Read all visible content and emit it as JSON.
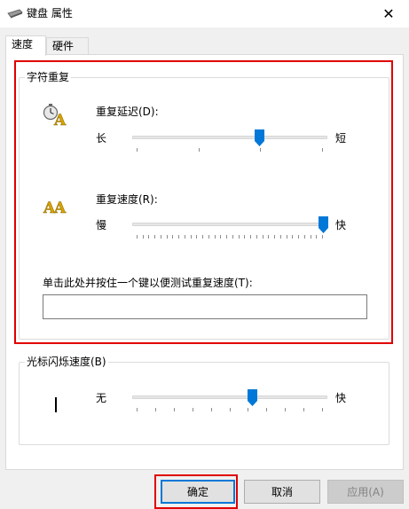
{
  "window": {
    "title": "键盘 属性",
    "icon": "keyboard-icon",
    "close_glyph": "✕"
  },
  "tabs": [
    {
      "label": "速度",
      "active": true
    },
    {
      "label": "硬件",
      "active": false
    }
  ],
  "char_repeat": {
    "legend": "字符重复",
    "delay": {
      "label": "重复延迟(D):",
      "min_label": "长",
      "max_label": "短",
      "icon": "repeat-delay-icon",
      "value_fraction": 0.66,
      "tick_count": 4
    },
    "rate": {
      "label": "重复速度(R):",
      "min_label": "慢",
      "max_label": "快",
      "icon": "repeat-rate-icon",
      "value_fraction": 1.0,
      "tick_count": 32
    },
    "test_label": "单击此处并按住一个键以便测试重复速度(T):",
    "test_value": ""
  },
  "cursor_blink": {
    "legend": "光标闪烁速度(B)",
    "min_label": "无",
    "max_label": "快",
    "value_fraction": 0.62,
    "tick_count": 11
  },
  "buttons": {
    "ok": "确定",
    "cancel": "取消",
    "apply": "应用(A)"
  },
  "colors": {
    "accent": "#0078d7",
    "highlight_box": "#e00000"
  }
}
